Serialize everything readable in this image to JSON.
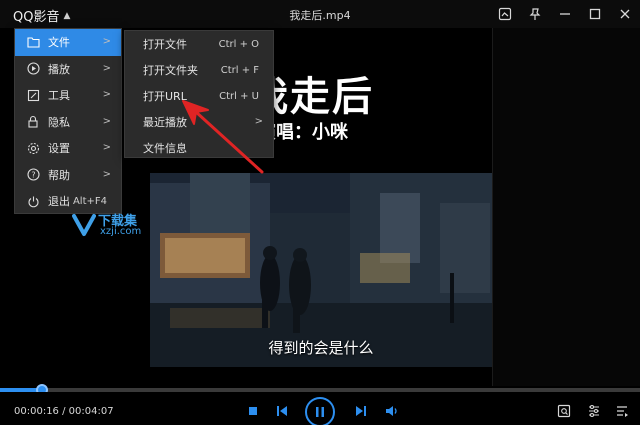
{
  "titlebar": {
    "app_name": "QQ影音",
    "file_title": "我走后.mp4"
  },
  "video": {
    "lyric_title": "我走后",
    "lyric_singer": "演唱：小咪",
    "subtitle": "得到的会是什么"
  },
  "main_menu": {
    "items": [
      {
        "label": "文件",
        "icon": "folder-icon",
        "has_submenu": true,
        "active": true
      },
      {
        "label": "播放",
        "icon": "play-circle-icon",
        "has_submenu": true
      },
      {
        "label": "工具",
        "icon": "tools-icon",
        "has_submenu": true
      },
      {
        "label": "隐私",
        "icon": "lock-icon",
        "has_submenu": true
      },
      {
        "label": "设置",
        "icon": "gear-icon",
        "has_submenu": true
      },
      {
        "label": "帮助",
        "icon": "help-icon",
        "has_submenu": true
      },
      {
        "label": "退出",
        "icon": "power-icon",
        "shortcut": "Alt+F4"
      }
    ]
  },
  "file_menu": {
    "items": [
      {
        "label": "打开文件",
        "shortcut": "Ctrl + O"
      },
      {
        "label": "打开文件夹",
        "shortcut": "Ctrl + F"
      },
      {
        "label": "打开URL",
        "shortcut": "Ctrl + U"
      },
      {
        "label": "最近播放",
        "has_submenu": true
      },
      {
        "label": "文件信息"
      }
    ]
  },
  "watermark": {
    "line1": "下载集",
    "line2": "xzji.com"
  },
  "playback": {
    "time": "00:00:16 / 00:04:07",
    "progress_fraction": 0.065
  },
  "colors": {
    "accent": "#2f8ae6",
    "annotation": "#e02424"
  }
}
